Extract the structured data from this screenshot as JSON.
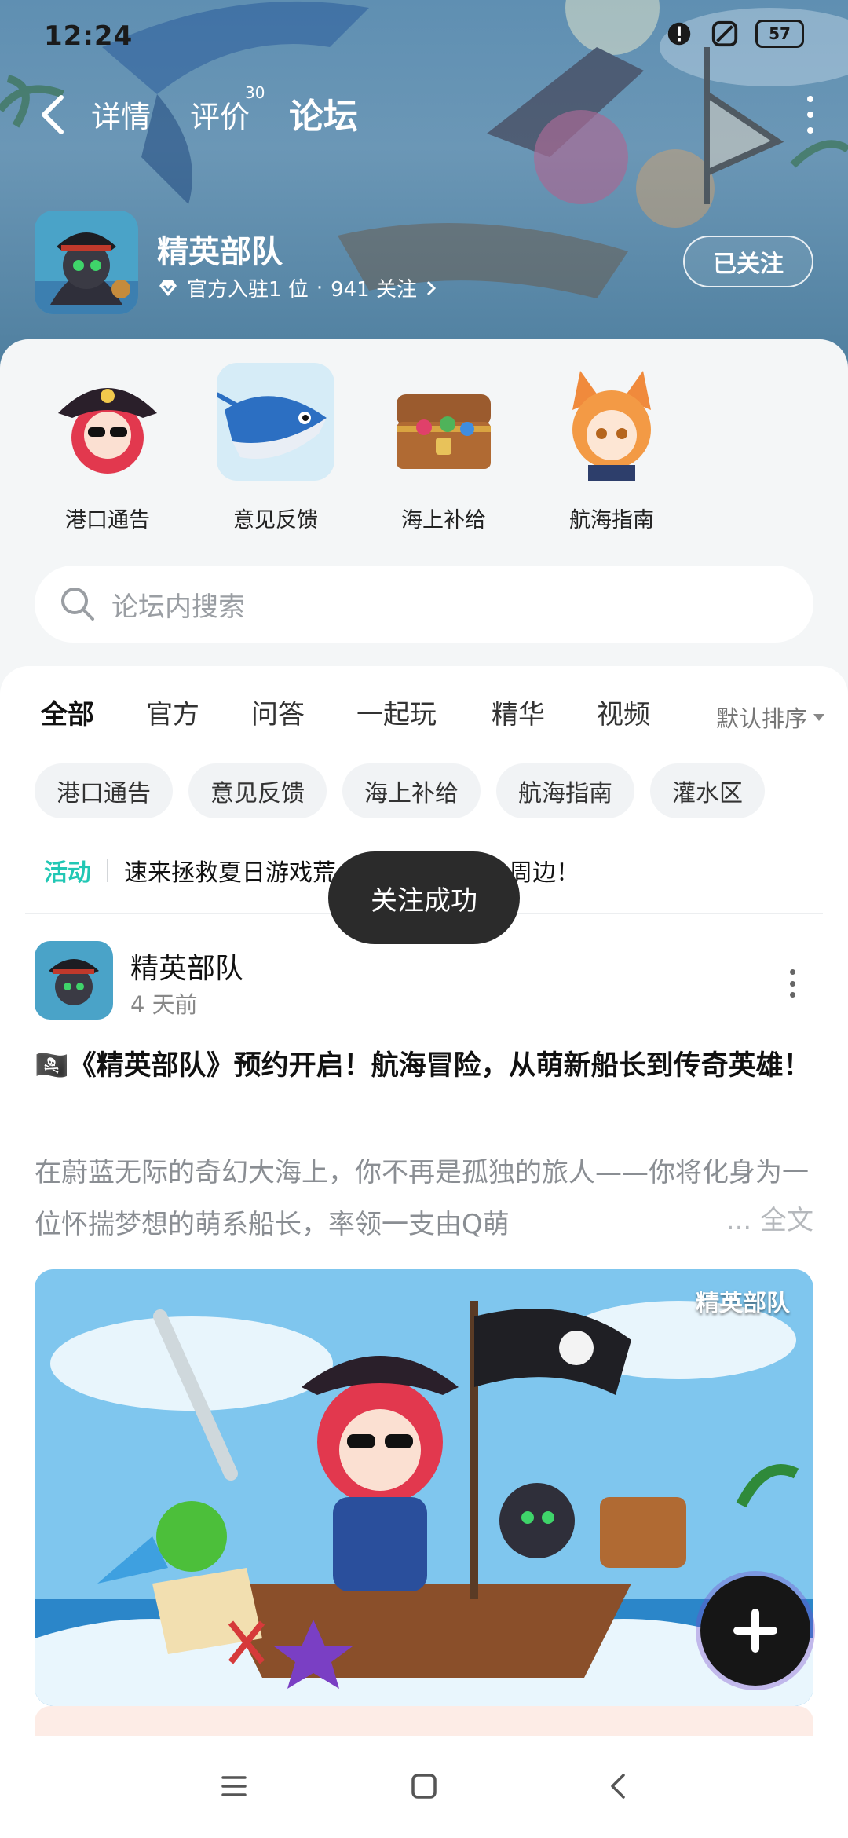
{
  "status_bar": {
    "time": "12:24",
    "battery": "57"
  },
  "topnav": {
    "tabs": [
      {
        "label": "详情"
      },
      {
        "label": "评价",
        "badge": "30"
      },
      {
        "label": "论坛",
        "active": true
      }
    ]
  },
  "game": {
    "name": "精英部队",
    "official_text": "官方入驻1 位",
    "followers_text": "941 关注",
    "follow_button": "已关注"
  },
  "sections": [
    {
      "label": "港口通告",
      "icon": "pirate-girl-icon"
    },
    {
      "label": "意见反馈",
      "icon": "swordfish-icon"
    },
    {
      "label": "海上补给",
      "icon": "treasure-chest-icon"
    },
    {
      "label": "航海指南",
      "icon": "fox-girl-icon"
    }
  ],
  "search": {
    "placeholder": "论坛内搜索"
  },
  "filter_tabs": [
    {
      "label": "全部",
      "active": true
    },
    {
      "label": "官方"
    },
    {
      "label": "问答"
    },
    {
      "label": "一起玩"
    },
    {
      "label": "精华"
    },
    {
      "label": "视频"
    }
  ],
  "sort": {
    "label": "默认排序"
  },
  "chips": [
    "港口通告",
    "意见反馈",
    "海上补给",
    "航海指南",
    "灌水区"
  ],
  "activity": {
    "tag": "活动",
    "text": "速来拯救夏日游戏荒",
    "text_tail": "周边！"
  },
  "post": {
    "author": "精英部队",
    "time": "4 天前",
    "title": "🏴‍☠️《精英部队》预约开启！航海冒险，从萌新船长到传奇英雄！",
    "excerpt": "在蔚蓝无际的奇幻大海上，你不再是孤独的旅人——你将化身为一位怀揣梦想的萌系船长，率领一支由Q萌",
    "more": "... 全文",
    "image_watermark": "精英部队"
  },
  "toast": "关注成功",
  "colors": {
    "accent": "#2fd6c0",
    "activity": "#21c7b4",
    "toast_bg": "#2b2b2b"
  }
}
